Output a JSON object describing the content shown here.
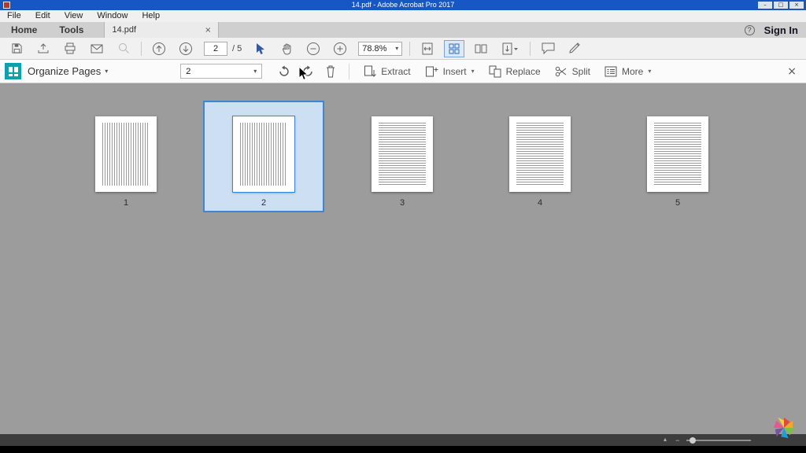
{
  "window": {
    "title": "14.pdf - Adobe Acrobat Pro 2017"
  },
  "icons": {
    "caret_down": "▾",
    "chevron_up": "▴",
    "close": "×",
    "help": "?",
    "minimize": "–",
    "maximize": "□",
    "minus": "–",
    "semantic": [
      "save-icon",
      "share-icon",
      "print-icon",
      "email-icon",
      "search-icon",
      "previous-page-icon",
      "next-page-icon",
      "select-tool-icon",
      "hand-tool-icon",
      "zoom-out-icon",
      "zoom-in-icon",
      "fit-page-icon",
      "page-thumbnails-icon",
      "two-page-view-icon",
      "scrolling-view-icon",
      "comment-icon",
      "pen-icon",
      "organize-pages-panel-icon",
      "rotate-ccw-icon",
      "rotate-cw-icon",
      "trash-icon",
      "extract-icon",
      "insert-icon",
      "replace-icon",
      "scissors-icon",
      "more-icon"
    ]
  },
  "menu": {
    "items": [
      "File",
      "Edit",
      "View",
      "Window",
      "Help"
    ]
  },
  "tabs": {
    "home": "Home",
    "tools": "Tools",
    "document": "14.pdf",
    "sign_in": "Sign In"
  },
  "toolbar": {
    "page_current": "2",
    "page_total": "/ 5",
    "zoom_value": "78.8%"
  },
  "organize": {
    "title": "Organize Pages",
    "page_range": "2",
    "buttons": {
      "extract": "Extract",
      "insert": "Insert",
      "replace": "Replace",
      "split": "Split",
      "more": "More"
    }
  },
  "thumbnails": {
    "pages": [
      {
        "label": "1"
      },
      {
        "label": "2"
      },
      {
        "label": "3"
      },
      {
        "label": "4"
      },
      {
        "label": "5"
      }
    ],
    "selected_page": "2"
  },
  "colors": {
    "titlebar": "#1656c5",
    "teal_accent": "#0ea1ad",
    "selection_border": "#3f86d2",
    "selection_fill": "#cddff2",
    "canvas_gray": "#9c9c9c"
  }
}
